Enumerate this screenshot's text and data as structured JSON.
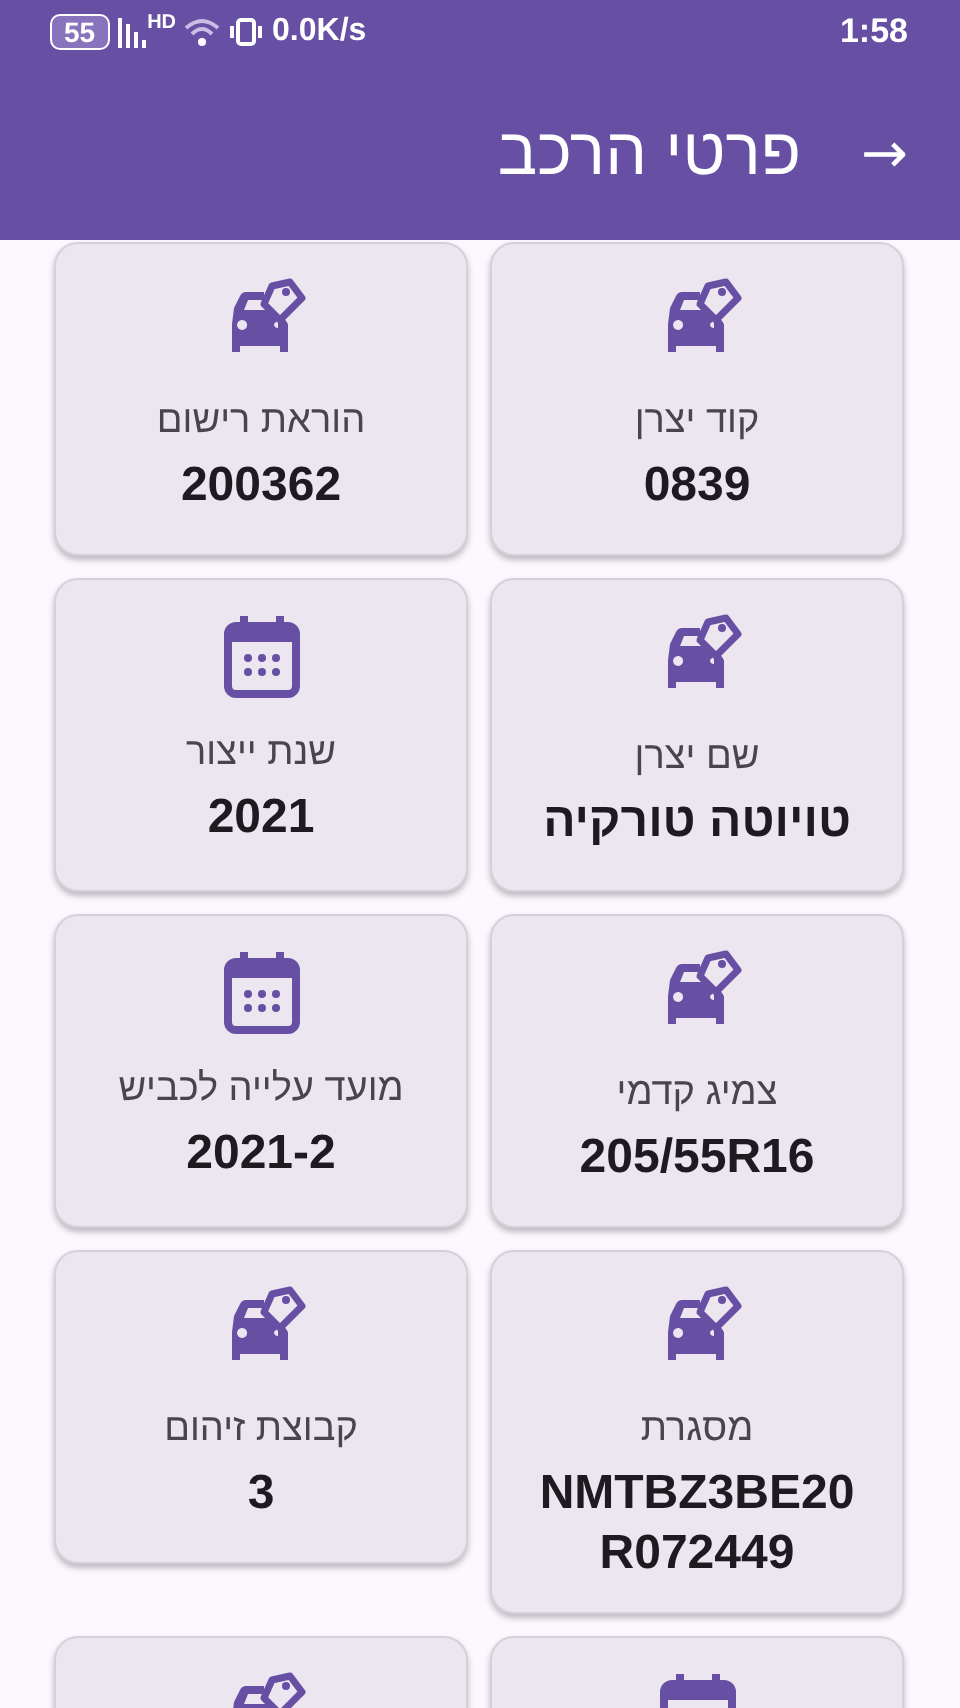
{
  "status_bar": {
    "battery": "55",
    "network_tag": "HD",
    "speed": "0.0K/s",
    "time": "1:58"
  },
  "app_bar": {
    "back": "→",
    "title": "פרטי הרכב"
  },
  "cards": [
    {
      "kind": "vehicle",
      "label": "קוד יצרן",
      "value": "0839"
    },
    {
      "kind": "vehicle",
      "label": "הוראת רישום",
      "value": "200362"
    },
    {
      "kind": "vehicle",
      "label": "שם יצרן",
      "value": "טויוטה טורקיה"
    },
    {
      "kind": "date",
      "label": "שנת ייצור",
      "value": "2021"
    },
    {
      "kind": "vehicle",
      "label": "צמיג קדמי",
      "value": "205/55R16"
    },
    {
      "kind": "date",
      "label": "מועד עלייה לכביש",
      "value": "2021-2"
    },
    {
      "kind": "vehicle",
      "label": "מסגרת",
      "value": "NMTBZ3BE20R072449"
    },
    {
      "kind": "vehicle",
      "label": "קבוצת זיהום",
      "value": "3"
    },
    {
      "kind": "date"
    },
    {
      "kind": "vehicle"
    }
  ]
}
